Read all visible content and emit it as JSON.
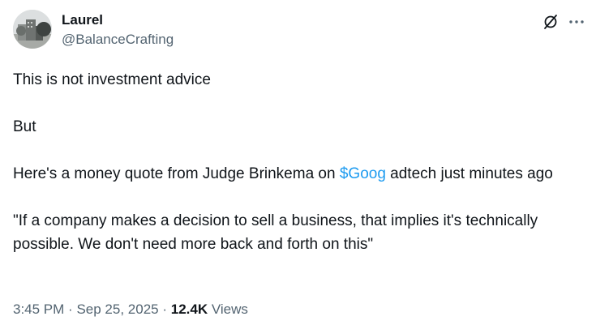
{
  "author": {
    "display_name": "Laurel",
    "handle": "@BalanceCrafting"
  },
  "tweet": {
    "line1": "This is not investment advice",
    "line2": "But",
    "line3_before": "Here's a money quote from Judge Brinkema on ",
    "cashtag": "$Goog",
    "line3_after": " adtech just minutes ago",
    "quote": "\"If a company makes a decision to sell a business, that implies it's technically possible. We don't need more back and forth on this\""
  },
  "meta": {
    "time": "3:45 PM",
    "separator": "·",
    "date": "Sep 25, 2025",
    "views_count": "12.4K",
    "views_label": "Views"
  },
  "icons": {
    "avatar": "avatar-photo",
    "grok": "grok-icon",
    "more": "more-horizontal-icon"
  },
  "colors": {
    "text_primary": "#0f1419",
    "text_secondary": "#536471",
    "link": "#1d9bf0",
    "background": "#ffffff"
  }
}
